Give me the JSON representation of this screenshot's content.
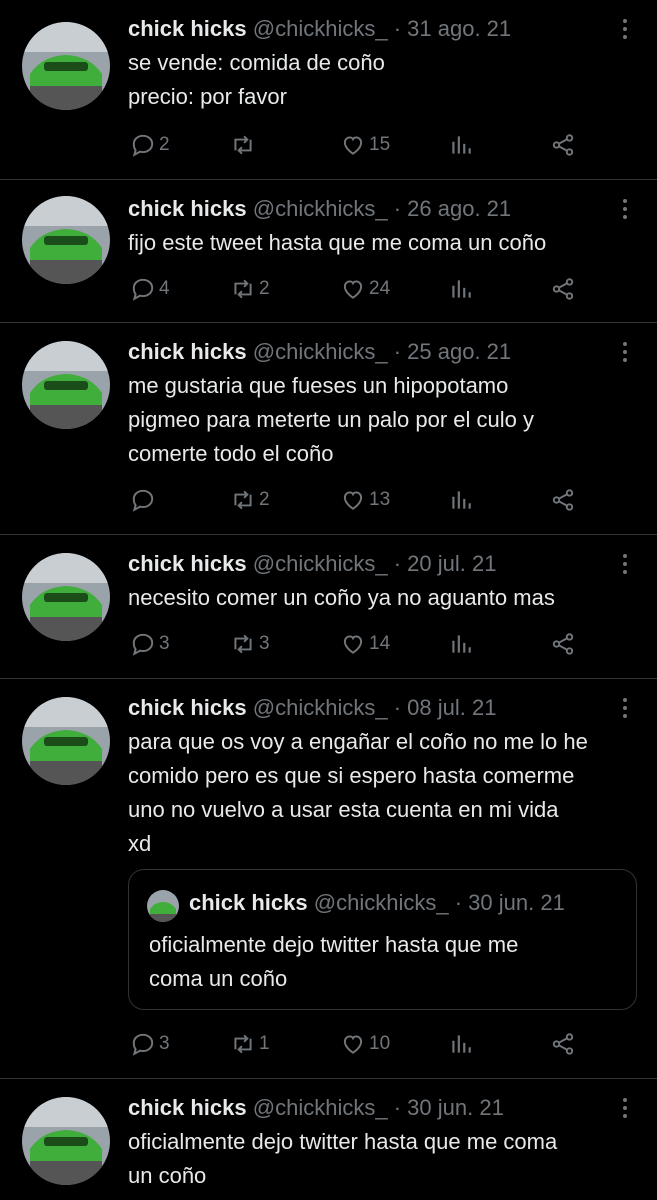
{
  "tweets": [
    {
      "name": "chick hicks",
      "handle": "@chickhicks_",
      "sep": "·",
      "date": "31 ago. 21",
      "text": "se vende: comida de coño\nprecio: por favor",
      "replies": "2",
      "retweets": "",
      "likes": "15"
    },
    {
      "name": "chick hicks",
      "handle": "@chickhicks_",
      "sep": "·",
      "date": "26 ago. 21",
      "text": "fijo este tweet hasta que me coma un coño",
      "replies": "4",
      "retweets": "2",
      "likes": "24"
    },
    {
      "name": "chick hicks",
      "handle": "@chickhicks_",
      "sep": "·",
      "date": "25 ago. 21",
      "text": "me gustaria que fueses un hipopotamo\npigmeo para meterte un palo por el culo y\ncomerte todo el coño",
      "replies": "",
      "retweets": "2",
      "likes": "13"
    },
    {
      "name": "chick hicks",
      "handle": "@chickhicks_",
      "sep": "·",
      "date": "20 jul. 21",
      "text": "necesito comer un coño ya no aguanto mas",
      "replies": "3",
      "retweets": "3",
      "likes": "14"
    },
    {
      "name": "chick hicks",
      "handle": "@chickhicks_",
      "sep": "·",
      "date": "08 jul. 21",
      "text": "para que os voy a engañar el coño no me lo he\ncomido pero es que si espero hasta comerme\nuno no vuelvo a usar esta cuenta en mi vida\nxd",
      "replies": "3",
      "retweets": "1",
      "likes": "10",
      "quote": {
        "name": "chick hicks",
        "handle": "@chickhicks_",
        "sep": "·",
        "date": "30 jun. 21",
        "text": "oficialmente dejo twitter hasta que me\ncoma un coño"
      }
    },
    {
      "name": "chick hicks",
      "handle": "@chickhicks_",
      "sep": "·",
      "date": "30 jun. 21",
      "text": "oficialmente dejo twitter hasta que me coma\nun coño",
      "replies": "",
      "retweets": "",
      "likes": ""
    }
  ],
  "colors": {
    "background": "#000000",
    "text": "#e7e9ea",
    "muted": "#71767b",
    "border": "#2f3336",
    "avatar_car": "#3fae3a"
  }
}
